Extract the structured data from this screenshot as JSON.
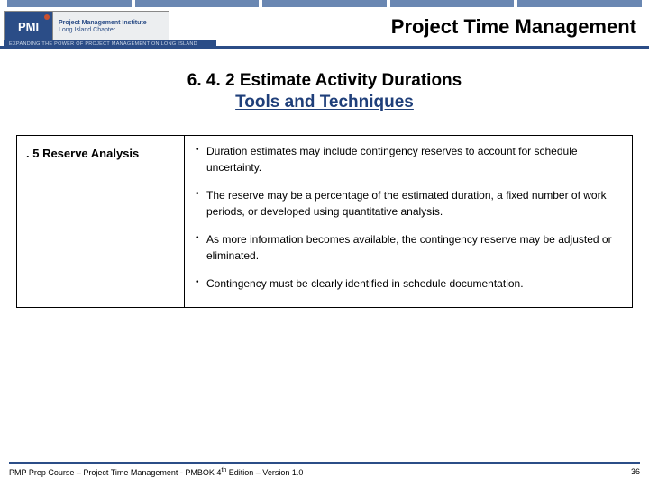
{
  "logo": {
    "mark": "PMI",
    "text_line1": "Project Management Institute",
    "text_line2": "Long Island Chapter",
    "sub": "EXPANDING THE POWER OF PROJECT MANAGEMENT ON LONG ISLAND"
  },
  "page_title": "Project Time Management",
  "heading": {
    "main": "6. 4. 2 Estimate Activity Durations",
    "sub": "Tools and Techniques"
  },
  "row": {
    "label": ". 5  Reserve Analysis",
    "bullets": [
      "Duration estimates may include contingency reserves to account for schedule uncertainty.",
      "The reserve may be a percentage of the estimated duration, a fixed number of work periods, or developed using quantitative analysis.",
      "As more information becomes available, the contingency reserve may be adjusted or eliminated.",
      "Contingency must be clearly identified in schedule documentation."
    ]
  },
  "footer": {
    "left_a": "PMP Prep Course – Project Time Management - PMBOK 4",
    "left_b": " Edition – Version 1.0",
    "sup": "th",
    "page": "36"
  }
}
